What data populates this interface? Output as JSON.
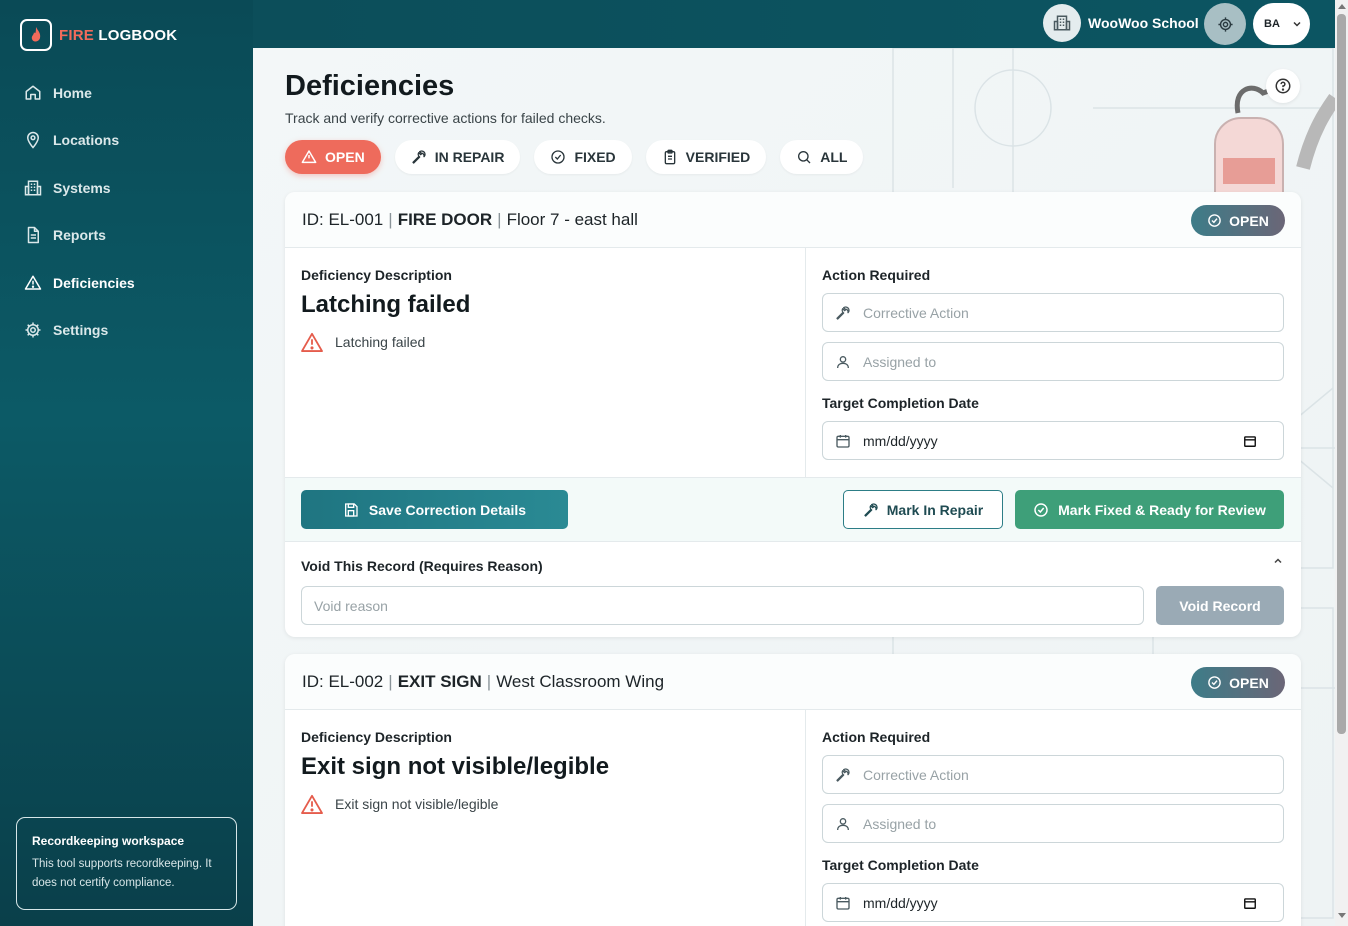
{
  "app": {
    "brand_fire": "FIRE",
    "brand_logbook": " LOGBOOK"
  },
  "sidebar": {
    "items": [
      {
        "label": "Home",
        "icon": "home-icon"
      },
      {
        "label": "Locations",
        "icon": "map-pin-icon"
      },
      {
        "label": "Systems",
        "icon": "building-icon"
      },
      {
        "label": "Reports",
        "icon": "document-icon"
      },
      {
        "label": "Deficiencies",
        "icon": "warning-icon",
        "active": true
      },
      {
        "label": "Settings",
        "icon": "gear-icon"
      }
    ],
    "record_card": {
      "title": "Recordkeeping workspace",
      "text": "This tool supports recordkeeping. It does not certify compliance."
    }
  },
  "topbar": {
    "school_name": "WooWoo School",
    "user_initials": "BA"
  },
  "page": {
    "title": "Deficiencies",
    "subtitle": "Track and verify corrective actions for failed checks."
  },
  "filters": [
    {
      "label": "OPEN",
      "icon": "warning-icon",
      "active": true
    },
    {
      "label": "IN REPAIR",
      "icon": "wrench-icon"
    },
    {
      "label": "FIXED",
      "icon": "check-circle-icon"
    },
    {
      "label": "VERIFIED",
      "icon": "clipboard-icon"
    },
    {
      "label": "ALL",
      "icon": "search-icon"
    }
  ],
  "form_labels": {
    "description": "Deficiency Description",
    "action_required": "Action Required",
    "corrective_placeholder": "Corrective Action",
    "assigned_placeholder": "Assigned to",
    "target_date": "Target Completion Date",
    "date_placeholder": "mm/dd/yyyy",
    "save": "Save Correction Details",
    "mark_repair": "Mark In Repair",
    "mark_fixed": "Mark Fixed & Ready for Review",
    "void_title": "Void This Record (Requires Reason)",
    "void_placeholder": "Void reason",
    "void_button": "Void Record"
  },
  "cards": [
    {
      "id_prefix": "ID: EL-001",
      "type": "FIRE DOOR",
      "location": "Floor 7 - east hall",
      "status": "OPEN",
      "title": "Latching failed",
      "note": "Latching failed"
    },
    {
      "id_prefix": "ID: EL-002",
      "type": "EXIT SIGN",
      "location": "West Classroom Wing",
      "status": "OPEN",
      "title": "Exit sign not visible/legible",
      "note": "Exit sign not visible/legible"
    }
  ],
  "colors": {
    "accent": "#ee6b5c",
    "teal": "#0c5562",
    "green": "#3e9f79"
  }
}
